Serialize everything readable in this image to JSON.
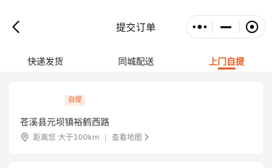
{
  "nav": {
    "title": "提交订单"
  },
  "tabs": [
    {
      "label": "快递发货",
      "active": false
    },
    {
      "label": "同城配送",
      "active": false
    },
    {
      "label": "上门自提",
      "active": true
    }
  ],
  "store": {
    "badge": "自提",
    "address": "苍溪县元坝镇裕鹤西路",
    "distance_label": "距离您 大于100km",
    "separator": "|",
    "map_link": "查看地图"
  },
  "icons": {
    "back": "chevron-left-icon",
    "more": "more-dots-icon",
    "minimize": "minus-icon",
    "close": "target-circle-icon",
    "location": "location-pin-icon",
    "arrow": "chevron-right-icon"
  },
  "colors": {
    "accent": "#e8602a",
    "badge_bg": "#fdeee7",
    "page_bg": "#f5f5f5"
  }
}
